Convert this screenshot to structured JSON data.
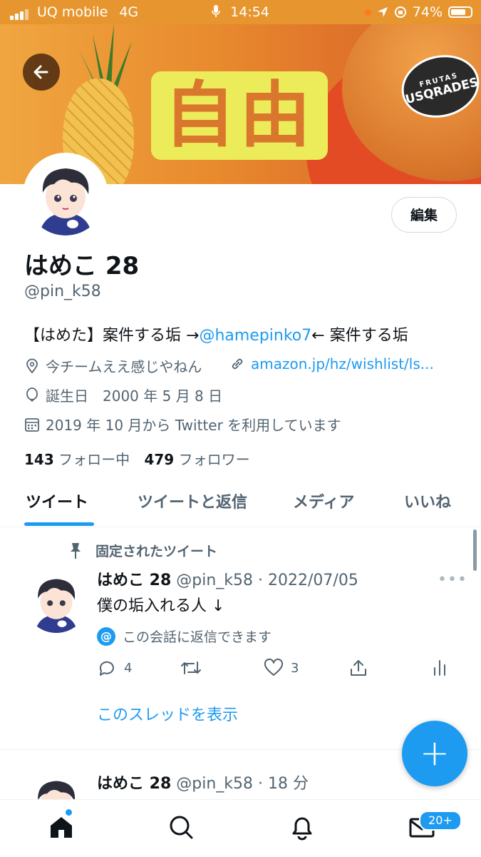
{
  "status_bar": {
    "carrier": "UQ mobile",
    "network": "4G",
    "time": "14:54",
    "battery": "74%"
  },
  "banner": {
    "kanji": "自由",
    "logo_top": "FRUTAS",
    "logo_main": "USQRADES"
  },
  "profile": {
    "edit_label": "編集",
    "name": "はめこ 28",
    "handle": "@pin_k58",
    "bio_prefix": "【はめた】案件する垢 →",
    "bio_mention": "@hamepinko7",
    "bio_suffix": "← 案件する垢",
    "location": "今チームええ感じやねん",
    "website": "amazon.jp/hz/wishlist/ls...",
    "birthday": "誕生日　2000 年 5 月 8 日",
    "joined": "2019 年 10 月から Twitter を利用しています",
    "following_count": "143",
    "following_label": "フォロー中",
    "followers_count": "479",
    "followers_label": "フォロワー"
  },
  "tabs": [
    {
      "label": "ツイート",
      "active": true
    },
    {
      "label": "ツイートと返信",
      "active": false
    },
    {
      "label": "メディア",
      "active": false
    },
    {
      "label": "いいね",
      "active": false
    }
  ],
  "pinned_tweet": {
    "pinned_label": "固定されたツイート",
    "name": "はめこ 28",
    "handle_date": "@pin_k58 · 2022/07/05",
    "text": "僕の垢入れる人 ↓",
    "reply_note": "この会話に返信できます",
    "reply_count": "4",
    "like_count": "3",
    "show_thread": "このスレッドを表示"
  },
  "second_tweet": {
    "name": "はめこ 28",
    "handle_time": "@pin_k58 · 18 分"
  },
  "fab_label": "+",
  "nav": {
    "messages_badge": "20+"
  },
  "colors": {
    "accent": "#1d9bf0",
    "status_bar": "#e7962f",
    "text_primary": "#0f1419",
    "text_secondary": "#536471"
  }
}
